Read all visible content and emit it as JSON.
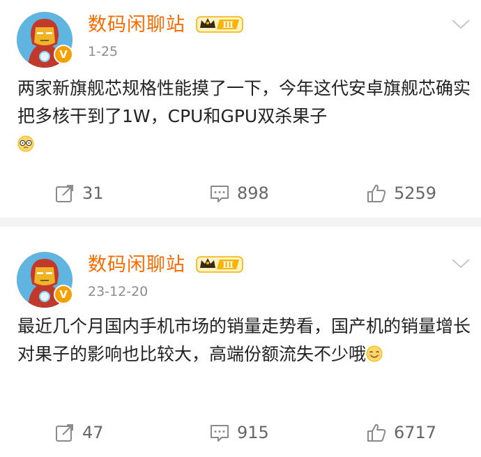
{
  "posts": [
    {
      "author": "数码闲聊站",
      "level": "Ⅲ",
      "date": "1-25",
      "text": "两家新旗舰芯规格性能摸了一下，今年这代安卓旗舰芯确实把多核干到了1W，CPU和GPU双杀果子",
      "emoji": "glasses-face-emoji",
      "repost_count": "31",
      "comment_count": "898",
      "like_count": "5259"
    },
    {
      "author": "数码闲聊站",
      "level": "Ⅲ",
      "date": "23-12-20",
      "text": "最近几个月国内手机市场的销量走势看，国产机的销量增长对果子的影响也比较大，高端份额流失不少哦",
      "emoji": "smile-face-emoji",
      "repost_count": "47",
      "comment_count": "915",
      "like_count": "6717"
    }
  ],
  "colors": {
    "author_name": "#f86b00",
    "verified_badge": "#f5a000",
    "level_badge": "#f7b500",
    "muted_text": "#8c8c8c",
    "divider": "#f2f2f2"
  },
  "icons": {
    "avatar": "iron-man-avatar",
    "verified": "verified-v-icon",
    "level": "crown-level-badge",
    "menu": "chevron-down-icon",
    "repost": "repost-icon",
    "comment": "comment-icon",
    "like": "like-icon"
  },
  "verified_mark": "V"
}
